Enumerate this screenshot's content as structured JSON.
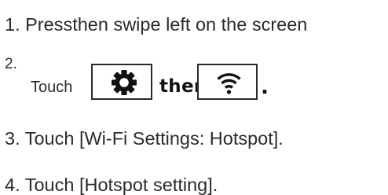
{
  "steps": {
    "step1": "1. Pressthen swipe left on the screen",
    "step2_number": "2.",
    "step2_touch": "Touch",
    "step2_then": "then",
    "step2_period": ".",
    "step3": "3. Touch [Wi-Fi Settings: Hotspot].",
    "step4": "4. Touch [Hotspot setting]."
  },
  "icons": {
    "settings": "gear-icon",
    "wifi": "wifi-icon"
  },
  "colors": {
    "text": "#2b2b2b",
    "icon": "#111111",
    "background": "#ffffff"
  }
}
